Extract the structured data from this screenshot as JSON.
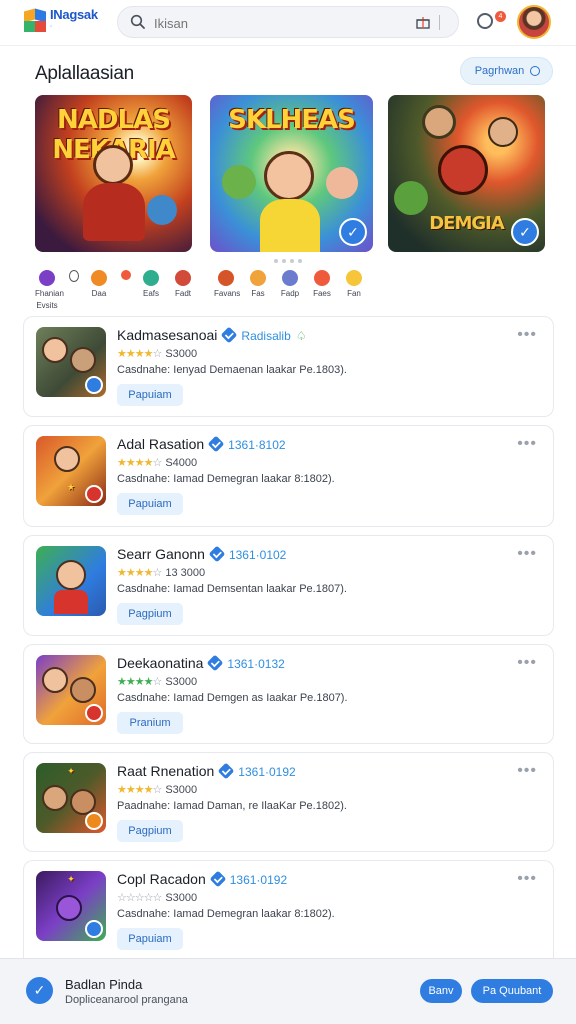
{
  "header": {
    "logo_text": "INagsak",
    "logo_sub": "◦",
    "search_placeholder": "Ikisan",
    "notification_count": "4"
  },
  "section": {
    "title": "Aplallaasian",
    "action_label": "Pagrhwan"
  },
  "featured": [
    {
      "title": "NADLAS NEKARIA"
    },
    {
      "title": "SKLHEAS"
    },
    {
      "title": "DEMGIA"
    }
  ],
  "chips_left": [
    {
      "label": "Fhanian",
      "color": "#7b3fc6"
    },
    {
      "label": "",
      "color": "#e8e8ea"
    },
    {
      "label": "Daa",
      "color": "#f08a24"
    },
    {
      "label": "",
      "color": "#ef5a3c"
    },
    {
      "label": "Eafs",
      "color": "#2fae8f"
    },
    {
      "label": "Fadt",
      "color": "#d24a3a"
    }
  ],
  "chips_left_sub": "Evsits",
  "chips_right": [
    {
      "label": "Favans",
      "color": "#d6542a"
    },
    {
      "label": "Fas",
      "color": "#f0a23b"
    },
    {
      "label": "Fadp",
      "color": "#6b7ccf"
    },
    {
      "label": "Faes",
      "color": "#ef5a3c"
    },
    {
      "label": "Fan",
      "color": "#f6c53a"
    }
  ],
  "apps": [
    {
      "name": "Kadmasesanoai",
      "code": "Radisalib",
      "stars_on": 4,
      "stars_green": false,
      "count": "S3000",
      "desc": "Casdnahe: Ienyad Demaenan laakar Pe.1803).",
      "button": "Papuiam"
    },
    {
      "name": "Adal Rasation",
      "code": "1361·8102",
      "stars_on": 4,
      "stars_green": false,
      "count": "S4000",
      "desc": "Casdnahe: Iamad Demegran laakar 8:1802).",
      "button": "Papuiam"
    },
    {
      "name": "Searr Ganonn",
      "code": "1361·0102",
      "stars_on": 4,
      "stars_green": false,
      "count": "13 3000",
      "desc": "Casdnahe: Iamad Demsentan laakar Pe.1807).",
      "button": "Pagpium"
    },
    {
      "name": "Deekaonatina",
      "code": "1361·0132",
      "stars_on": 4,
      "stars_green": true,
      "count": "S3000",
      "desc": "Casdnahe: Iamad Demgen as Iaakar Pe.1807).",
      "button": "Pranium"
    },
    {
      "name": "Raat Rnenation",
      "code": "1361·0192",
      "stars_on": 4,
      "stars_green": false,
      "count": "S3000",
      "desc": "Paadnahe: Iamad Daman, re IlaaKar Pe.1802).",
      "button": "Pagpium"
    },
    {
      "name": "Copl Racadon",
      "code": "1361·0192",
      "stars_on": 0,
      "stars_green": false,
      "count": "S3000",
      "desc": "Casdnahe: Iamad Demegran laakar 8:1802).",
      "button": "Papuiam"
    }
  ],
  "bottom_bar": {
    "title": "Badlan Pinda",
    "subtitle": "Dopliceanarool prangana",
    "button1": "Banv",
    "button2": "Pa Quubant"
  }
}
